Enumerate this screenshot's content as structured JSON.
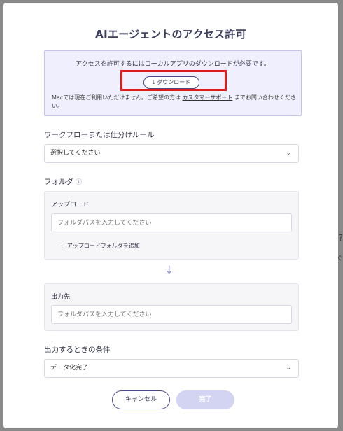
{
  "dialog": {
    "title": "AIエージェントのアクセス許可",
    "notice": {
      "text": "アクセスを許可するにはローカルアプリのダウンロードが必要です。",
      "download_label": "ダウンロード",
      "mac_note_prefix": "Macでは現在ご利用いただけません。ご希望の方は",
      "mac_note_link": "カスタマーサポート",
      "mac_note_suffix": "までお問い合わせください。"
    },
    "workflow": {
      "label": "ワークフローまたは仕分けルール",
      "selected": "選択してください"
    },
    "folder": {
      "label": "フォルダ",
      "upload": {
        "label": "アップロード",
        "placeholder": "フォルダパスを入力してください",
        "add_label": "アップロードフォルダを追加"
      },
      "output": {
        "label": "出力先",
        "placeholder": "フォルダパスを入力してください"
      }
    },
    "condition": {
      "label": "出力するときの条件",
      "selected": "データ化完了"
    },
    "buttons": {
      "cancel": "キャンセル",
      "done": "完了"
    }
  },
  "background_glyphs": [
    "?",
    "ぐ"
  ],
  "colors": {
    "accent": "#4a4a8c",
    "notice_bg": "#efeffd",
    "highlight": "#e11a1a",
    "done_disabled": "#d3d3f2"
  },
  "icons": {
    "download": "download-icon",
    "help": "help-circle-icon",
    "chevron": "chevron-down-icon",
    "plus": "plus-icon",
    "arrow": "arrow-down-icon"
  }
}
